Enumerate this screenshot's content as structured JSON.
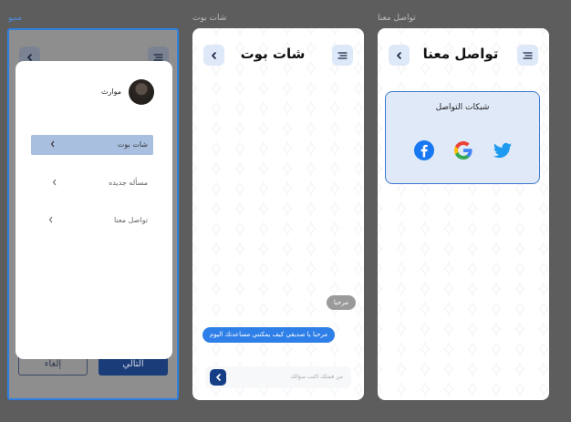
{
  "frames": {
    "menu": {
      "label": "منيو"
    },
    "chat": {
      "label": "شات بوت"
    },
    "contact": {
      "label": "تواصل معنا"
    }
  },
  "menu_screen": {
    "user_name": "موارث",
    "items": [
      {
        "label": "شات بوت",
        "active": true
      },
      {
        "label": "مسأله جديده",
        "active": false
      },
      {
        "label": "تواصل معنا",
        "active": false
      }
    ],
    "behind_buttons": {
      "next": "التالي",
      "cancel": "إلغاء"
    }
  },
  "chat_screen": {
    "title": "شات بوت",
    "incoming_message": "مرحبا",
    "bot_message": "مرحبا يا صديقي كيف يمكنني مساعدتك اليوم",
    "input_placeholder": "من فضلك اكتب سؤالك"
  },
  "contact_screen": {
    "title": "تواصل معنا",
    "card_title": "شبكات التواصل",
    "networks": [
      "facebook-icon",
      "google-icon",
      "twitter-icon"
    ]
  },
  "colors": {
    "accent": "#2f7fe8",
    "send_button": "#143f86",
    "icon_bg": "#dde8f8",
    "selection": "#2f7fe0"
  }
}
